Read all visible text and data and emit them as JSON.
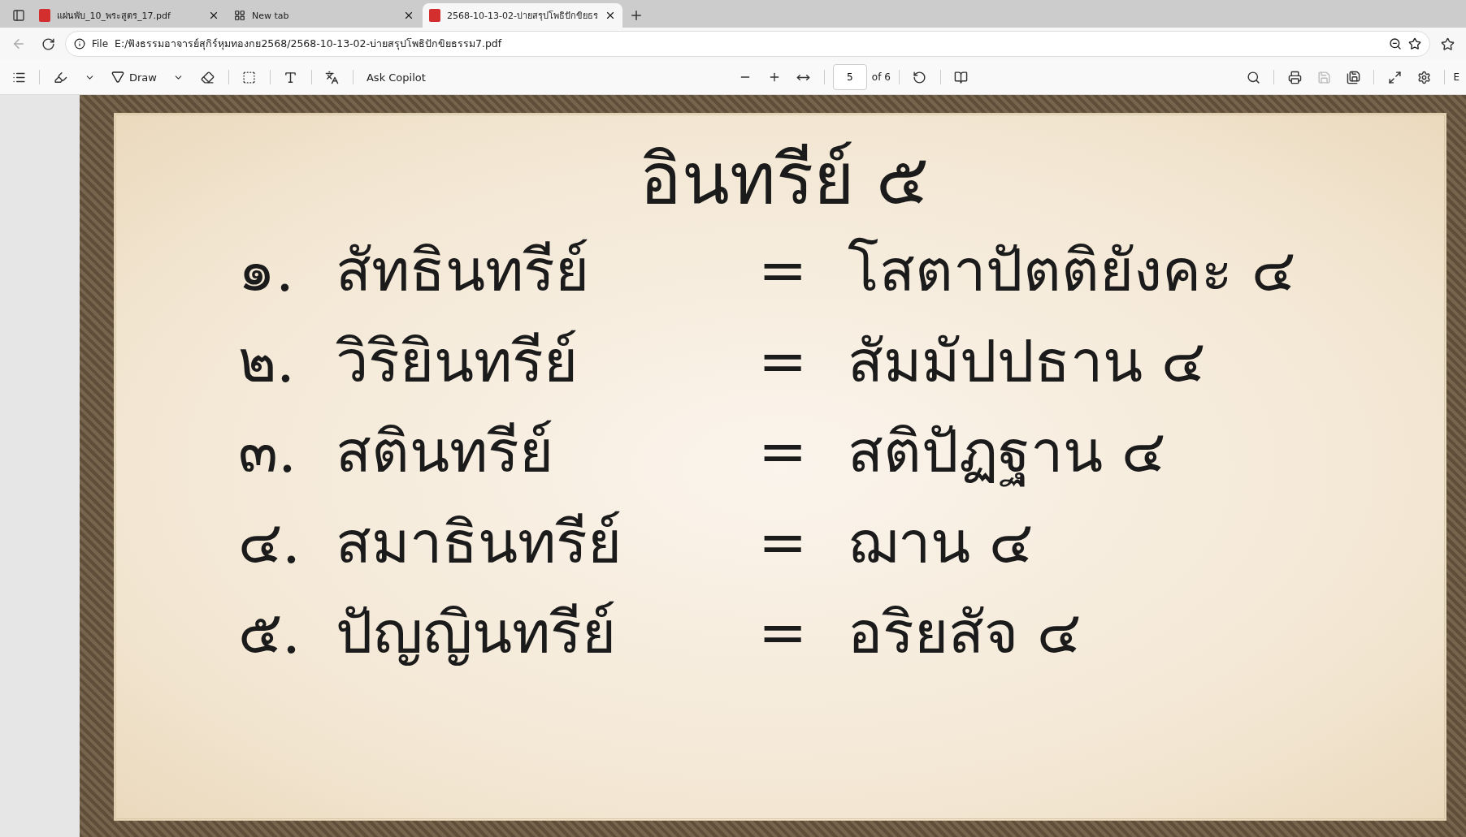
{
  "tabs": [
    {
      "kind": "pdf",
      "title": "แผ่นพับ_10_พระสูตร_17.pdf",
      "selected": false
    },
    {
      "kind": "newtab",
      "title": "New tab",
      "selected": false
    },
    {
      "kind": "pdf",
      "title": "2568-10-13-02-บ่ายสรุปโพธิปักขิยธร",
      "selected": true
    }
  ],
  "address_bar": {
    "scheme": "File",
    "url": "E:/ฟังธรรมอาจารย์สุกิร์หุมทองกย2568/2568-10-13-02-บ่ายสรุปโพธิปักขิยธรรม7.pdf"
  },
  "pdf_toolbar": {
    "draw_label": "Draw",
    "copilot_label": "Ask Copilot",
    "page_number": "5",
    "page_total": "of 6",
    "edge_text": "E"
  },
  "page": {
    "title": "อินทรีย์ ๕",
    "items": [
      {
        "number": "๑.",
        "term": "สัทธินทรีย์",
        "sign": "=",
        "meaning": "โสตาปัตติยังคะ ๔"
      },
      {
        "number": "๒.",
        "term": "วิริยินทรีย์",
        "sign": "=",
        "meaning": "สัมมัปปธาน ๔"
      },
      {
        "number": "๓.",
        "term": "สตินทรีย์",
        "sign": "=",
        "meaning": "สติปัฏฐาน ๔"
      },
      {
        "number": "๔.",
        "term": "สมาธินทรีย์",
        "sign": "=",
        "meaning": "ฌาน ๔"
      },
      {
        "number": "๕.",
        "term": "ปัญญินทรีย์",
        "sign": "=",
        "meaning": "อริยสัจ ๔"
      }
    ]
  }
}
